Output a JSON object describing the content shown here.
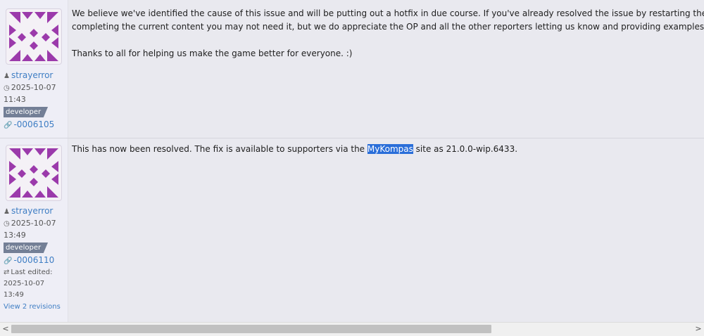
{
  "posts": [
    {
      "username": "strayerror",
      "date": "2025-10-07",
      "time": "11:43",
      "role": "developer",
      "post_id": "-0006105",
      "paragraphs": [
        "We believe we've identified the cause of this issue and will be putting out a hotfix in due course. If you've already resolved the issue by restarting the ga",
        "completing the current content you may not need it, but we do appreciate the OP and all the other reporters letting us know and providing examples so",
        "Thanks to all for helping us make the game better for everyone. :)"
      ]
    },
    {
      "username": "strayerror",
      "date": "2025-10-07",
      "time": "13:49",
      "role": "developer",
      "post_id": "-0006110",
      "edited_label": "Last edited:",
      "edited_date": "2025-10-07",
      "edited_time": "13:49",
      "revisions_link": "View 2 revisions",
      "body_before": "This has now been resolved. The fix is available to supporters via the ",
      "body_link": "MyKompas",
      "body_after": " site as 21.0.0-wip.6433."
    }
  ],
  "scrollbar": {
    "left_arrow": "<",
    "right_arrow": ">"
  },
  "icons": {
    "user": "user-icon",
    "clock": "clock-icon",
    "link": "link-icon",
    "edit": "retweet-icon"
  },
  "colors": {
    "accent": "#3f7ec4",
    "badge": "#737f96",
    "avatar_purple": "#9b3aab",
    "selection": "#2a6ed9"
  }
}
